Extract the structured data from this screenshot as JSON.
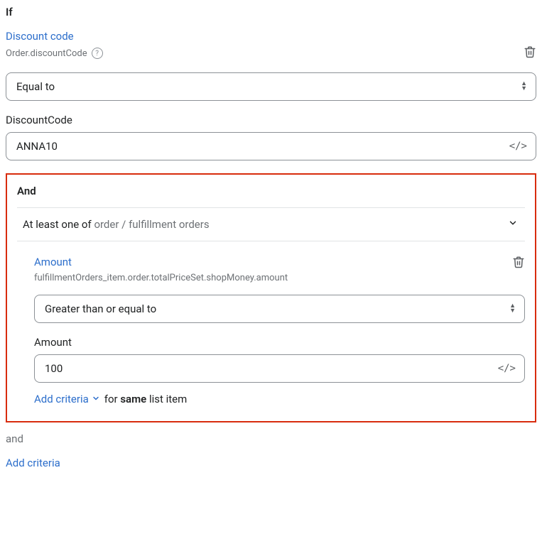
{
  "top": {
    "if_label": "If",
    "discount_code_link": "Discount code",
    "discount_code_path": "Order.discountCode",
    "operator_selected": "Equal to",
    "value_label": "DiscountCode",
    "value_text": "ANNA10"
  },
  "middle": {
    "and_label": "And",
    "collapse_prefix": "At least one of ",
    "collapse_muted": "order / fulfillment orders",
    "amount_link": "Amount",
    "amount_path": "fulfillmentOrders_item.order.totalPriceSet.shopMoney.amount",
    "operator_selected": "Greater than or equal to",
    "value_label": "Amount",
    "value_text": "100",
    "add_criteria": "Add criteria",
    "same_prefix": "for ",
    "same_bold": "same",
    "same_suffix": " list item"
  },
  "bottom": {
    "and_label": "and",
    "add_criteria": "Add criteria"
  }
}
